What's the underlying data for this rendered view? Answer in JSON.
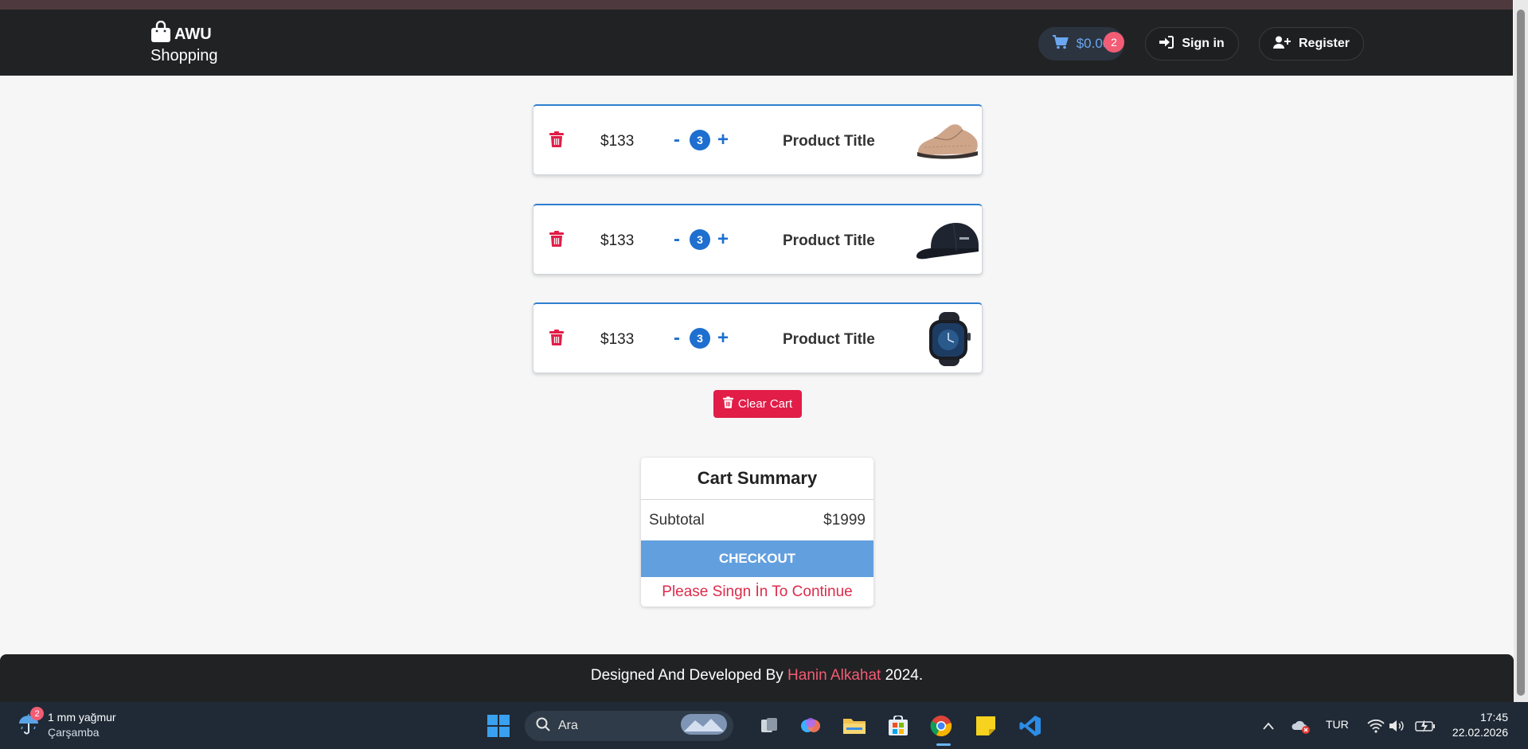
{
  "brand": {
    "name": "AWU",
    "subtitle": "Shopping"
  },
  "nav": {
    "cart_total": "$0.00",
    "cart_count": "2",
    "signin_label": "Sign in",
    "register_label": "Register"
  },
  "cart_items": [
    {
      "price": "$133",
      "qty": "3",
      "title": "Product Title",
      "image": "sneaker"
    },
    {
      "price": "$133",
      "qty": "3",
      "title": "Product Title",
      "image": "cap"
    },
    {
      "price": "$133",
      "qty": "3",
      "title": "Product Title",
      "image": "watch"
    }
  ],
  "qty_minus": "-",
  "qty_plus": "+",
  "clear_cart_label": "Clear Cart",
  "summary": {
    "title": "Cart Summary",
    "subtotal_label": "Subtotal",
    "subtotal_value": "$1999",
    "checkout_label": "CHECKOUT",
    "note": "Please Singn İn To Continue"
  },
  "footer": {
    "prefix": "Designed And Developed By",
    "author": "Hanin Alkahat",
    "suffix": "2024."
  },
  "taskbar": {
    "weather_badge": "2",
    "weather_main": "1 mm yağmur",
    "weather_sub": "Çarşamba",
    "search_placeholder": "Ara",
    "language": "TUR",
    "time": "17:45",
    "date": "22.02.2026"
  },
  "colors": {
    "accent_blue": "#1e6fcf",
    "danger_red": "#e11d48",
    "navbar_bg": "#212223",
    "checkout_bg": "#629fdf"
  }
}
